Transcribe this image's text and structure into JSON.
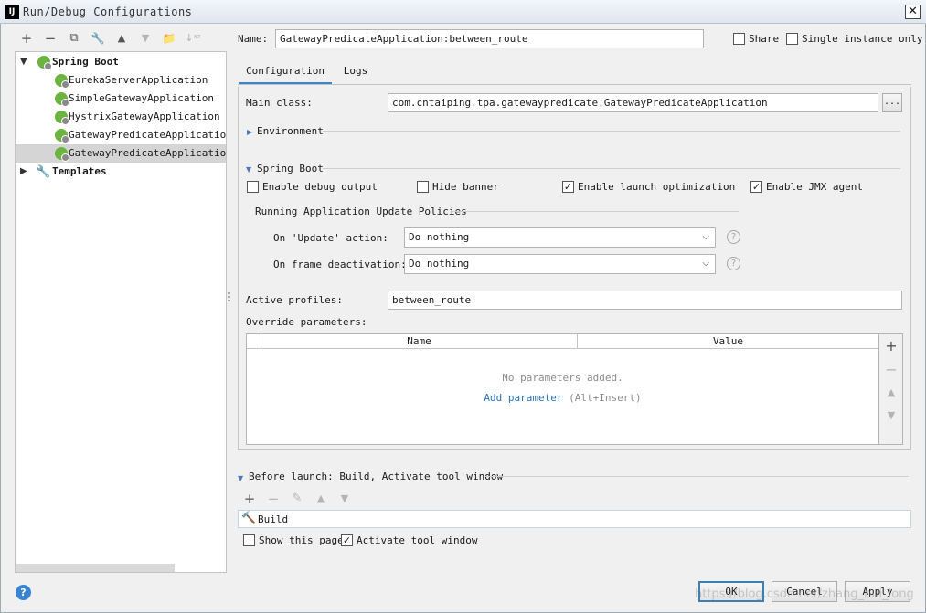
{
  "window": {
    "title": "Run/Debug Configurations",
    "app_icon": "IJ",
    "close": "✕"
  },
  "toolbar": {
    "add": "+",
    "remove": "−",
    "copy": "⧉",
    "edit": "🔧",
    "up": "▲",
    "down": "▼",
    "folder": "📁",
    "sort": "↓ᵃᶻ"
  },
  "tree": {
    "root": {
      "label": "Spring Boot",
      "expander": "▼"
    },
    "items": [
      {
        "label": "EurekaServerApplication"
      },
      {
        "label": "SimpleGatewayApplication"
      },
      {
        "label": "HystrixGatewayApplication"
      },
      {
        "label": "GatewayPredicateApplication:s"
      },
      {
        "label": "GatewayPredicateApplication:b",
        "selected": true
      }
    ],
    "templates": {
      "label": "Templates",
      "expander": "▶"
    }
  },
  "name_row": {
    "label": "Name:",
    "value": "GatewayPredicateApplication:between_route",
    "share_label": "Share",
    "single_instance_label": "Single instance only"
  },
  "tabs": [
    {
      "label": "Configuration",
      "active": true
    },
    {
      "label": "Logs",
      "active": false
    }
  ],
  "main_class": {
    "label": "Main class:",
    "value": "com.cntaiping.tpa.gatewaypredicate.GatewayPredicateApplication",
    "browse": "..."
  },
  "environment": {
    "label": "Environment",
    "arrow": "▶"
  },
  "spring_boot": {
    "label": "Spring Boot",
    "arrow": "▼",
    "options": [
      {
        "label": "Enable debug output",
        "checked": false
      },
      {
        "label": "Hide banner",
        "checked": false
      },
      {
        "label": "Enable launch optimization",
        "checked": true
      },
      {
        "label": "Enable JMX agent",
        "checked": true
      }
    ],
    "check_mark": "✓",
    "policies_title": "Running Application Update Policies",
    "update_action": {
      "label": "On 'Update' action:",
      "value": "Do nothing"
    },
    "frame_deactivation": {
      "label": "On frame deactivation:",
      "value": "Do nothing"
    },
    "dropdown_arrow": "⌵",
    "help": "?"
  },
  "active_profiles": {
    "label": "Active profiles:",
    "value": "between_route"
  },
  "override": {
    "label": "Override parameters:",
    "columns": [
      "Name",
      "Value"
    ],
    "empty": "No parameters added.",
    "add_link": "Add parameter",
    "shortcut": "(Alt+Insert)",
    "side": {
      "add": "+",
      "remove": "−",
      "up": "▲",
      "down": "▼"
    }
  },
  "before_launch": {
    "label": "Before launch: Build, Activate tool window",
    "arrow": "▼",
    "toolbar": {
      "add": "+",
      "remove": "−",
      "edit": "✎",
      "up": "▲",
      "down": "▼"
    },
    "build_label": "Build",
    "hammer": "🔨",
    "show_page_label": "Show this page",
    "activate_label": "Activate tool window"
  },
  "buttons": {
    "ok": "OK",
    "cancel": "Cancel",
    "apply": "Apply",
    "help": "?"
  },
  "watermark": "https://blog.csdn.net/zhang_hui_long"
}
